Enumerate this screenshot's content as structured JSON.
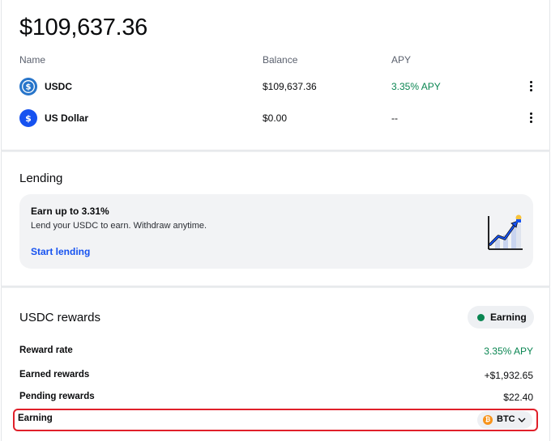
{
  "balance": {
    "total": "$109,637.36",
    "columns": {
      "name": "Name",
      "balance": "Balance",
      "apy": "APY"
    },
    "assets": [
      {
        "name": "USDC",
        "balance": "$109,637.36",
        "apy": "3.35% APY",
        "icon": "usdc-icon",
        "color": "#2775ca"
      },
      {
        "name": "US Dollar",
        "balance": "$0.00",
        "apy": "--",
        "icon": "dollar-icon",
        "color": "#1652f0"
      }
    ]
  },
  "lending": {
    "title": "Lending",
    "promo_title": "Earn up to 3.31%",
    "promo_subtitle": "Lend your USDC to earn. Withdraw anytime.",
    "cta": "Start lending",
    "illustration": "growth-chart-icon"
  },
  "rewards": {
    "title": "USDC rewards",
    "status": "Earning",
    "status_color": "#098551",
    "rows": [
      {
        "label": "Reward rate",
        "value": "3.35% APY"
      },
      {
        "label": "Earned rewards",
        "value": "+$1,932.65"
      },
      {
        "label": "Pending rewards",
        "value": "$22.40"
      }
    ],
    "earning_label": "Earning",
    "earning_coin": "BTC",
    "earning_coin_symbol": "₿"
  },
  "colors": {
    "accent": "#1652f0",
    "positive": "#098551",
    "highlight": "#e0202a"
  }
}
